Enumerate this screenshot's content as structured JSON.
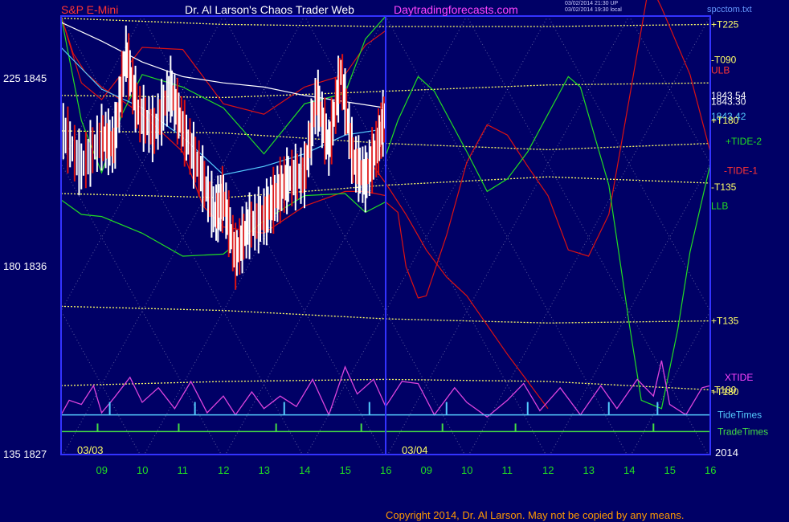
{
  "header": {
    "symbol": "S&P E-Mini",
    "title": "Dr. Al Larson's Chaos Trader Web",
    "site": "Daytradingforecasts.com",
    "stamp_line1": "03/02/2014 21:30 UP",
    "stamp_line2": "03/02/2014 19:30 local",
    "filename": "spcctom.txt"
  },
  "footer": {
    "copyright": "Copyright 2014, Dr. Al Larson. May not be copied by any means."
  },
  "colors": {
    "background": "#000066",
    "frame": "#3333ff",
    "yellow": "#ffff66",
    "red": "#dd1111",
    "green": "#22dd22",
    "white": "#ffffff",
    "cyan": "#55ccff",
    "magenta": "#dd44dd",
    "lime": "#44dd44",
    "symbol_text": "#ff3333",
    "site_text": "#ff44ff"
  },
  "chart_data": {
    "type": "line",
    "title": "S&P E-Mini",
    "y_axis": {
      "range": [
        1827,
        1848
      ],
      "ticks": [
        {
          "value": 1845,
          "label": "225  1845"
        },
        {
          "value": 1836,
          "label": "180  1836"
        },
        {
          "value": 1827,
          "label": "135  1827"
        }
      ]
    },
    "x_axis": {
      "hour_labels": [
        "09",
        "10",
        "11",
        "12",
        "13",
        "14",
        "15",
        "16",
        "09",
        "10",
        "11",
        "12",
        "13",
        "14",
        "15",
        "16"
      ],
      "date_labels": [
        {
          "label": "03/03",
          "slot": 0
        },
        {
          "label": "03/04",
          "slot": 8
        }
      ],
      "year_label": "2014"
    },
    "grid": "diagonal dotted price-time lattice",
    "right_labels": [
      {
        "text": "+T225",
        "color": "#ffff66",
        "value": 1847.6
      },
      {
        "text": "-T090",
        "color": "#ffff66",
        "value": 1845.9
      },
      {
        "text": "ULB",
        "color": "#ff3333",
        "value": 1845.4
      },
      {
        "text": "1843.54",
        "color": "#ffffff",
        "value": 1844.2
      },
      {
        "text": "1843.30",
        "color": "#ffffff",
        "value": 1843.9
      },
      {
        "text": "1843.42",
        "color": "#55ccff",
        "value": 1843.2
      },
      {
        "text": "+T180",
        "color": "#ffff66",
        "value": 1843.0
      },
      {
        "text": "+TIDE-2",
        "color": "#22dd22",
        "value": 1842.0
      },
      {
        "text": "-TIDE-1",
        "color": "#ff3333",
        "value": 1840.6
      },
      {
        "text": "-T135",
        "color": "#ffff66",
        "value": 1839.8
      },
      {
        "text": "LLB",
        "color": "#22dd22",
        "value": 1838.9
      },
      {
        "text": "+T135",
        "color": "#ffff66",
        "value": 1833.4
      },
      {
        "text": "XTIDE",
        "color": "#ff44ff",
        "value": 1830.7
      },
      {
        "text": "-T180",
        "color": "#ffff66",
        "value": 1830.1
      },
      {
        "text": "+T180",
        "color": "#ffff66",
        "value": 1830.0
      },
      {
        "text": "TideTimes",
        "color": "#55ccff",
        "value": 1828.9
      },
      {
        "text": "TradeTimes",
        "color": "#44dd44",
        "value": 1828.1
      }
    ],
    "series": [
      {
        "color": "#ffff66",
        "points": [
          [
            0,
            1847.9
          ],
          [
            4,
            1847.6
          ],
          [
            8,
            1847.5
          ],
          [
            12,
            1847.5
          ],
          [
            16,
            1847.6
          ]
        ]
      },
      {
        "color": "#ffff66",
        "points": [
          [
            0,
            1844.2
          ],
          [
            4,
            1844.1
          ],
          [
            8,
            1844.4
          ],
          [
            12,
            1844.7
          ],
          [
            16,
            1844.8
          ]
        ]
      },
      {
        "color": "#ffff66",
        "points": [
          [
            0,
            1842.5
          ],
          [
            4,
            1842.4
          ],
          [
            8,
            1841.9
          ],
          [
            12,
            1841.6
          ],
          [
            16,
            1841.9
          ]
        ]
      },
      {
        "color": "#ffff66",
        "points": [
          [
            0,
            1839.5
          ],
          [
            4,
            1839.3
          ],
          [
            8,
            1839.9
          ],
          [
            12,
            1840.3
          ],
          [
            16,
            1840.0
          ]
        ]
      },
      {
        "color": "#ffff66",
        "points": [
          [
            0,
            1834.1
          ],
          [
            4,
            1833.9
          ],
          [
            8,
            1833.5
          ],
          [
            12,
            1833.3
          ],
          [
            16,
            1833.4
          ]
        ]
      },
      {
        "color": "#ffff66",
        "points": [
          [
            0,
            1830.3
          ],
          [
            4,
            1830.5
          ],
          [
            8,
            1830.6
          ],
          [
            12,
            1830.5
          ],
          [
            16,
            1830.1
          ]
        ]
      },
      {
        "color": "#dd1111",
        "points": [
          [
            0,
            1848
          ],
          [
            0.3,
            1846.2
          ],
          [
            0.6,
            1845.3
          ],
          [
            1,
            1844.6
          ],
          [
            2,
            1843.3
          ],
          [
            3,
            1841.5
          ],
          [
            3.5,
            1838.9
          ],
          [
            4,
            1837.9
          ],
          [
            5,
            1837.6
          ],
          [
            6,
            1838.9
          ],
          [
            7,
            1839.6
          ],
          [
            7.5,
            1839.6
          ],
          [
            8,
            1839.4
          ]
        ]
      },
      {
        "color": "#dd1111",
        "points": [
          [
            0,
            1848
          ],
          [
            0.5,
            1844.8
          ],
          [
            1,
            1844
          ],
          [
            2,
            1846.5
          ],
          [
            3,
            1846.4
          ],
          [
            4,
            1843.8
          ],
          [
            5,
            1843.3
          ],
          [
            6,
            1844.6
          ],
          [
            7,
            1845.2
          ],
          [
            7.5,
            1846.6
          ],
          [
            8,
            1847.3
          ]
        ]
      },
      {
        "color": "#dd1111",
        "points": [
          [
            8,
            1839.1
          ],
          [
            8.3,
            1838.6
          ],
          [
            8.5,
            1836
          ],
          [
            8.8,
            1834.5
          ],
          [
            9,
            1834.6
          ],
          [
            9.5,
            1837.5
          ],
          [
            10,
            1841
          ],
          [
            10.5,
            1842.8
          ],
          [
            11,
            1842.3
          ],
          [
            11.5,
            1840.8
          ],
          [
            12,
            1839.4
          ],
          [
            12.5,
            1836.8
          ],
          [
            13,
            1836.5
          ],
          [
            13.5,
            1838.5
          ],
          [
            14,
            1844
          ],
          [
            14.5,
            1849.6
          ],
          [
            14.8,
            1848.4
          ],
          [
            15.5,
            1845.2
          ],
          [
            16,
            1841.5
          ]
        ]
      },
      {
        "color": "#dd1111",
        "points": [
          [
            7.5,
            1841.3
          ],
          [
            8,
            1840
          ],
          [
            8.5,
            1838.5
          ],
          [
            9,
            1836.8
          ],
          [
            9.5,
            1835.5
          ],
          [
            10,
            1834.6
          ],
          [
            10.5,
            1833.2
          ],
          [
            11,
            1831.8
          ],
          [
            11.5,
            1830.5
          ],
          [
            12,
            1829.2
          ]
        ]
      },
      {
        "color": "#22dd22",
        "points": [
          [
            0,
            1848
          ],
          [
            0.5,
            1843
          ],
          [
            1,
            1840.5
          ],
          [
            1.5,
            1843.3
          ],
          [
            2,
            1845.2
          ],
          [
            3,
            1844.6
          ],
          [
            4,
            1843.6
          ],
          [
            5,
            1841.4
          ],
          [
            6,
            1843.8
          ],
          [
            7,
            1844.3
          ],
          [
            7.5,
            1846.9
          ],
          [
            8,
            1848.0
          ]
        ]
      },
      {
        "color": "#22dd22",
        "points": [
          [
            0,
            1839.2
          ],
          [
            0.5,
            1838.5
          ],
          [
            1,
            1838.4
          ],
          [
            2,
            1837.6
          ],
          [
            3,
            1836.5
          ],
          [
            4,
            1836.6
          ],
          [
            5,
            1838.2
          ],
          [
            6,
            1839.4
          ],
          [
            7,
            1839.5
          ],
          [
            7.5,
            1838.6
          ],
          [
            8,
            1839.1
          ]
        ]
      },
      {
        "color": "#22dd22",
        "points": [
          [
            8,
            1841.3
          ],
          [
            8.3,
            1843
          ],
          [
            8.8,
            1845.1
          ],
          [
            9.2,
            1844.4
          ],
          [
            10,
            1841.5
          ],
          [
            10.5,
            1839.6
          ],
          [
            11,
            1840.2
          ],
          [
            11.5,
            1841.5
          ],
          [
            12,
            1843.3
          ],
          [
            12.5,
            1845.1
          ],
          [
            12.8,
            1844.6
          ],
          [
            13.5,
            1839.9
          ],
          [
            14,
            1833.3
          ],
          [
            14.3,
            1829.6
          ],
          [
            14.8,
            1829.2
          ],
          [
            15.2,
            1833
          ],
          [
            15.5,
            1836.7
          ],
          [
            16,
            1840.9
          ]
        ]
      },
      {
        "color": "#ffffff",
        "points": [
          [
            0,
            1847.7
          ],
          [
            1,
            1846.8
          ],
          [
            2,
            1845.8
          ],
          [
            3,
            1845.1
          ],
          [
            4,
            1844.8
          ],
          [
            5,
            1844.6
          ],
          [
            6,
            1844.2
          ],
          [
            7,
            1843.9
          ],
          [
            8,
            1843.6
          ]
        ]
      },
      {
        "color": "#55ccff",
        "points": [
          [
            0,
            1846.5
          ],
          [
            1,
            1844.5
          ],
          [
            2,
            1843.6
          ],
          [
            3,
            1842.2
          ],
          [
            4,
            1840.4
          ],
          [
            5,
            1840.8
          ],
          [
            6,
            1841.4
          ],
          [
            7,
            1842.3
          ],
          [
            8,
            1842.6
          ]
        ]
      }
    ],
    "price_bars_path": [
      [
        0,
        1842.7
      ],
      [
        0.5,
        1840.8
      ],
      [
        1,
        1842.2
      ],
      [
        1.3,
        1841.8
      ],
      [
        1.6,
        1846.2
      ],
      [
        1.9,
        1843.4
      ],
      [
        2.3,
        1842.5
      ],
      [
        2.7,
        1844.5
      ],
      [
        3,
        1842.6
      ],
      [
        3.4,
        1840.7
      ],
      [
        3.8,
        1838.5
      ],
      [
        4,
        1839.3
      ],
      [
        4.3,
        1836.5
      ],
      [
        4.6,
        1837.9
      ],
      [
        5,
        1838.4
      ],
      [
        5.3,
        1839.4
      ],
      [
        5.6,
        1840.2
      ],
      [
        6,
        1840.4
      ],
      [
        6.3,
        1844.1
      ],
      [
        6.6,
        1841.7
      ],
      [
        6.9,
        1845.3
      ],
      [
        7.2,
        1841.1
      ],
      [
        7.5,
        1840.2
      ],
      [
        7.8,
        1841.8
      ],
      [
        8,
        1843.4
      ]
    ],
    "xtide_path": [
      [
        0,
        1828.9
      ],
      [
        0.2,
        1829.6
      ],
      [
        0.5,
        1829.4
      ],
      [
        0.8,
        1830.3
      ],
      [
        1,
        1829
      ],
      [
        1.3,
        1829.7
      ],
      [
        1.7,
        1830.7
      ],
      [
        2,
        1829.5
      ],
      [
        2.4,
        1830.2
      ],
      [
        2.8,
        1829.2
      ],
      [
        3.2,
        1830.5
      ],
      [
        3.6,
        1829
      ],
      [
        4,
        1829.8
      ],
      [
        4.3,
        1828.9
      ],
      [
        4.7,
        1830.0
      ],
      [
        5,
        1829.2
      ],
      [
        5.4,
        1829.8
      ],
      [
        5.8,
        1829.3
      ],
      [
        6.2,
        1830.6
      ],
      [
        6.6,
        1828.9
      ],
      [
        7,
        1831.2
      ],
      [
        7.3,
        1829.9
      ],
      [
        7.7,
        1830.6
      ],
      [
        8,
        1829.3
      ],
      [
        8.4,
        1830.5
      ],
      [
        8.8,
        1830.4
      ],
      [
        9.2,
        1828.9
      ],
      [
        9.7,
        1830.2
      ],
      [
        10,
        1829.5
      ],
      [
        10.5,
        1828.8
      ],
      [
        11,
        1829.6
      ],
      [
        11.4,
        1830.4
      ],
      [
        11.8,
        1829.1
      ],
      [
        12.3,
        1830.2
      ],
      [
        12.8,
        1828.9
      ],
      [
        13.3,
        1830.3
      ],
      [
        13.7,
        1829.2
      ],
      [
        14.2,
        1830.6
      ],
      [
        14.6,
        1829.8
      ],
      [
        14.8,
        1831.5
      ],
      [
        15,
        1829.4
      ],
      [
        15.4,
        1828.9
      ],
      [
        15.8,
        1830.2
      ],
      [
        16,
        1830.3
      ]
    ],
    "tide_spikes": [
      1.2,
      3.3,
      5.5,
      7.6,
      9.5,
      11.5,
      13.5,
      14.7
    ],
    "trade_spikes": [
      0.9,
      2.9,
      5.3,
      7.4,
      9.4,
      11.2,
      14.6
    ]
  }
}
